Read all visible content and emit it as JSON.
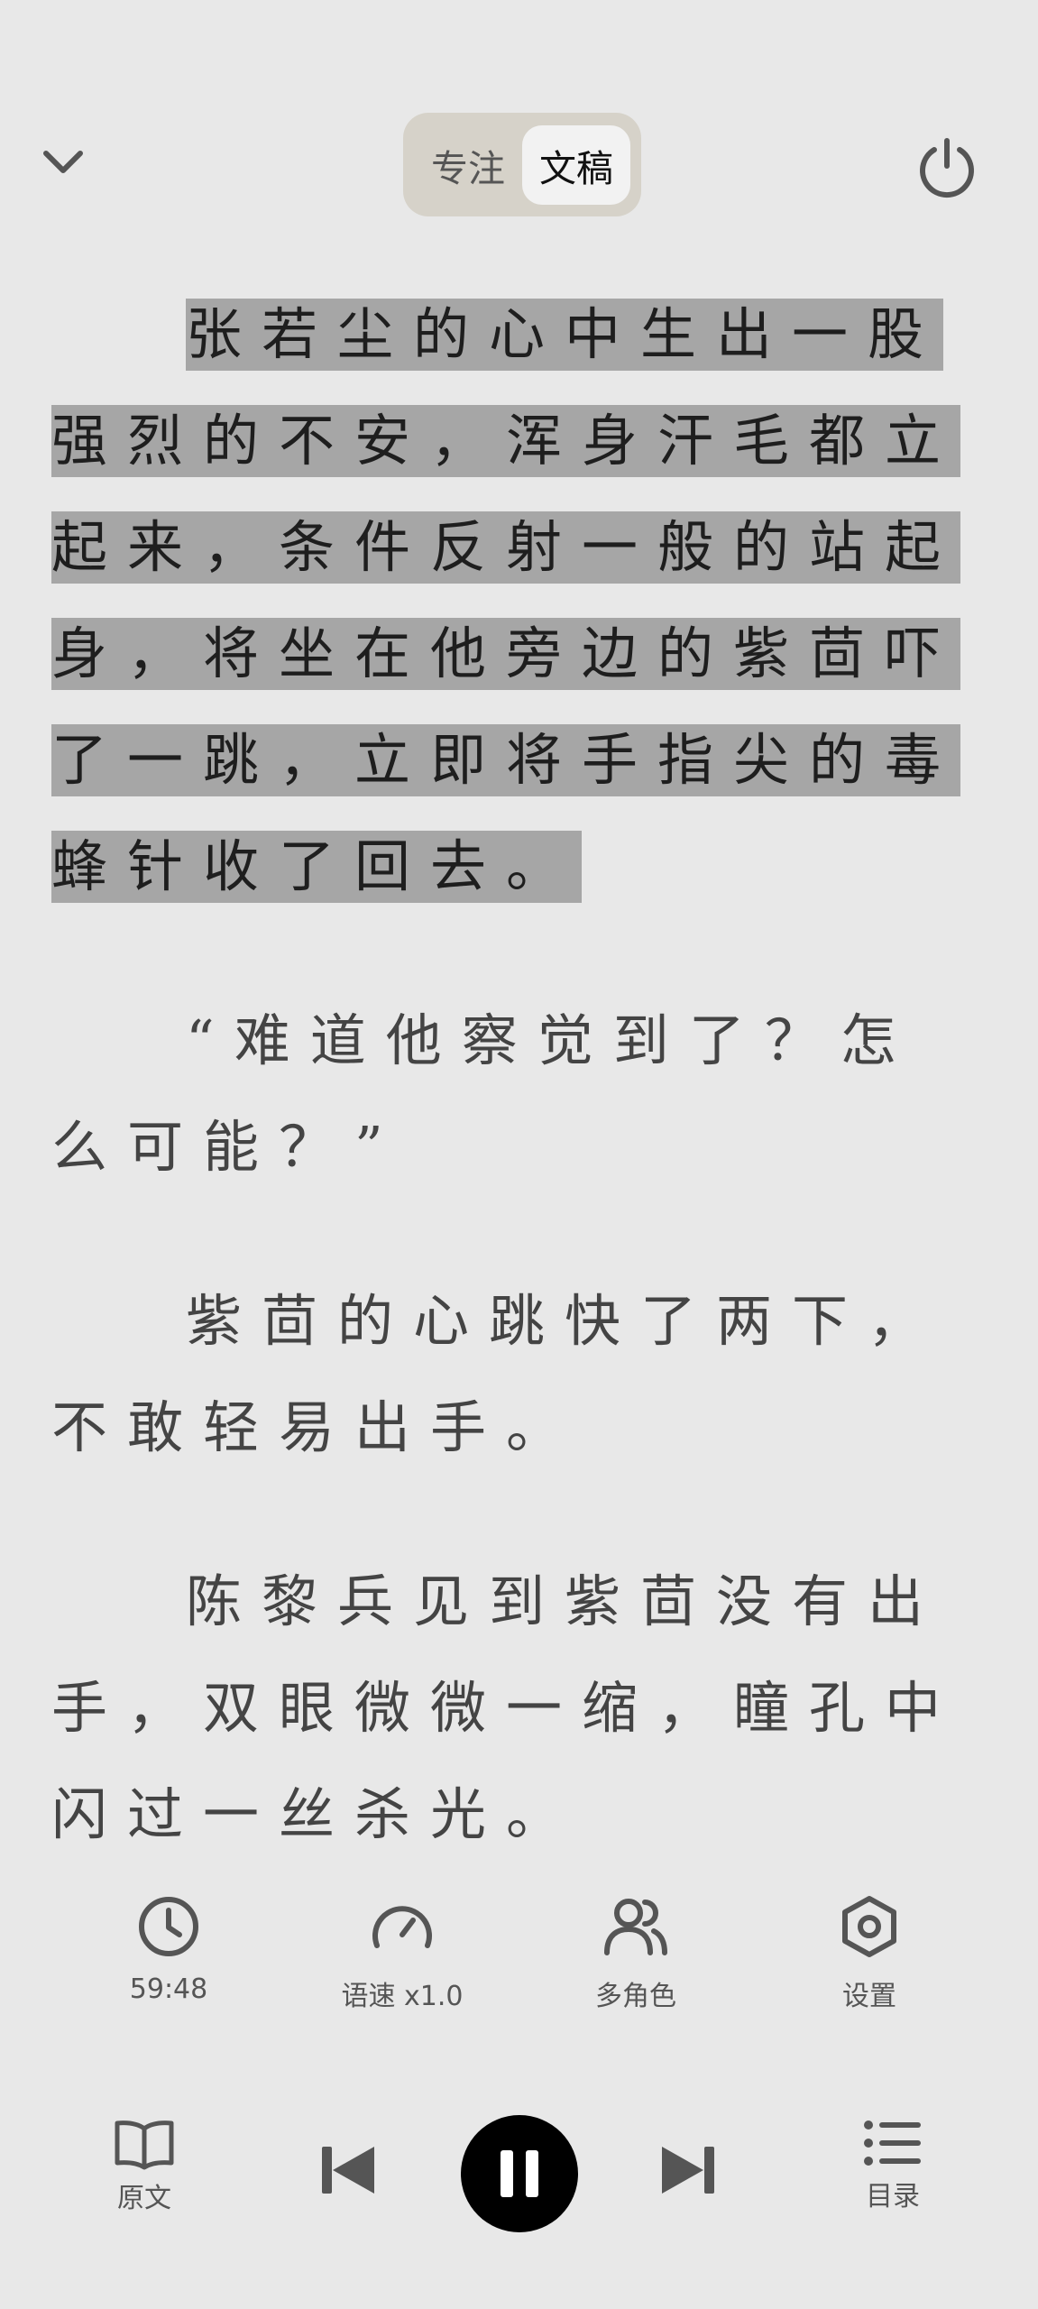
{
  "topbar": {
    "collapse_icon": "chevron-down-icon",
    "mode_options": [
      "专注",
      "文稿"
    ],
    "active_mode": "文稿",
    "power_icon": "power-icon"
  },
  "content": {
    "paragraphs": [
      "张若尘的心中生出一股强烈的不安，浑身汗毛都立起来，条件反射一般的站起身，将坐在他旁边的紫茴吓了一跳，立即将手指尖的毒蜂针收了回去。",
      "“难道他察觉到了？怎么可能？”",
      "紫茴的心跳快了两下，不敢轻易出手。",
      "陈黎兵见到紫茴没有出手，双眼微微一缩，瞳孔中闪过一丝杀光。"
    ],
    "highlighted_paragraph": 0
  },
  "functions": {
    "timer": {
      "icon": "clock-icon",
      "label": "59:48"
    },
    "speed": {
      "icon": "speedometer-icon",
      "label": "语速 x1.0"
    },
    "roles": {
      "icon": "people-icon",
      "label": "多角色"
    },
    "settings": {
      "icon": "settings-hexagon-icon",
      "label": "设置"
    }
  },
  "player": {
    "original": {
      "icon": "book-icon",
      "label": "原文"
    },
    "prev_icon": "skip-previous-icon",
    "play_icon": "pause-icon",
    "next_icon": "skip-next-icon",
    "toc": {
      "icon": "list-icon",
      "label": "目录"
    }
  },
  "colors": {
    "background": "#e8e8e8",
    "highlight": "#a6a6a6",
    "toggle_bg": "#d6d2c9"
  }
}
